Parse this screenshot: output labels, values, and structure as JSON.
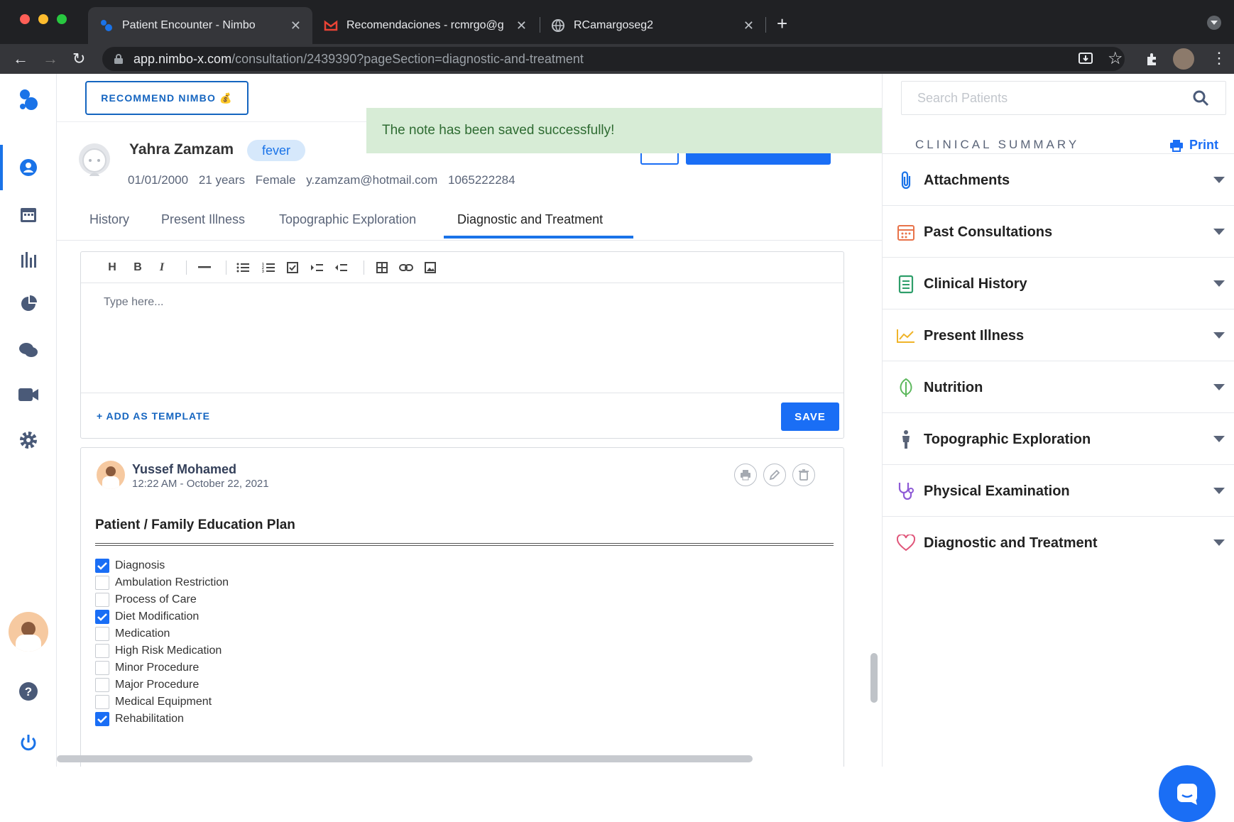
{
  "browser": {
    "tabs": [
      {
        "title": "Patient Encounter - Nimbo"
      },
      {
        "title": "Recomendaciones - rcmrgo@g"
      },
      {
        "title": "RCamargoseg2"
      }
    ],
    "url_host": "app.nimbo-x.com",
    "url_path": "/consultation/2439390?pageSection=diagnostic-and-treatment",
    "new_tab": "+"
  },
  "topbar": {
    "recommend_label": "RECOMMEND NIMBO 💰"
  },
  "toast": {
    "message": "The note has been saved successfully!"
  },
  "patient": {
    "name": "Yahra Zamzam",
    "tag": "fever",
    "dob": "01/01/2000",
    "age": "21 years",
    "sex": "Female",
    "email": "y.zamzam@hotmail.com",
    "phone": "1065222284"
  },
  "tabs": [
    "History",
    "Present Illness",
    "Topographic Exploration",
    "Diagnostic and Treatment"
  ],
  "editor": {
    "toolbar": {
      "heading": "H",
      "bold": "B",
      "italic": "I"
    },
    "placeholder": "Type here...",
    "add_template": "+ ADD AS TEMPLATE",
    "save": "SAVE"
  },
  "note": {
    "author": "Yussef Mohamed",
    "timestamp": "12:22 AM - October 22, 2021",
    "title": "Patient / Family Education Plan",
    "checklist": [
      {
        "label": "Diagnosis",
        "checked": true
      },
      {
        "label": "Ambulation Restriction",
        "checked": false
      },
      {
        "label": "Process of Care",
        "checked": false
      },
      {
        "label": "Diet Modification",
        "checked": true
      },
      {
        "label": "Medication",
        "checked": false
      },
      {
        "label": "High Risk Medication",
        "checked": false
      },
      {
        "label": "Minor Procedure",
        "checked": false
      },
      {
        "label": "Major Procedure",
        "checked": false
      },
      {
        "label": "Medical Equipment",
        "checked": false
      },
      {
        "label": "Rehabilitation",
        "checked": true
      }
    ]
  },
  "search": {
    "placeholder": "Search Patients"
  },
  "summary": {
    "title": "CLINICAL SUMMARY",
    "print": "Print",
    "items": [
      {
        "label": "Attachments",
        "icon": "paperclip-icon",
        "color": "#1a73e8"
      },
      {
        "label": "Past Consultations",
        "icon": "calendar-icon",
        "color": "#e8734a"
      },
      {
        "label": "Clinical History",
        "icon": "clipboard-icon",
        "color": "#2e9e6a"
      },
      {
        "label": "Present Illness",
        "icon": "trend-icon",
        "color": "#f0b429"
      },
      {
        "label": "Nutrition",
        "icon": "leaf-icon",
        "color": "#5cb85c"
      },
      {
        "label": "Topographic Exploration",
        "icon": "body-icon",
        "color": "#5a6478"
      },
      {
        "label": "Physical Examination",
        "icon": "stethoscope-icon",
        "color": "#8e5bd6"
      },
      {
        "label": "Diagnostic and Treatment",
        "icon": "heart-icon",
        "color": "#e0567a"
      }
    ]
  }
}
